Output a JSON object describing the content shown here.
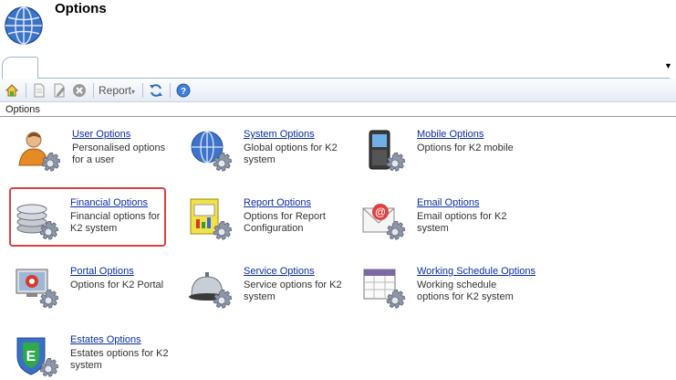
{
  "header": {
    "title": "Options",
    "icon": "globe-icon"
  },
  "toolbar": {
    "report_label": "Report",
    "buttons": [
      "home-icon",
      "new-document-icon",
      "edit-document-icon",
      "delete-icon",
      "refresh-icon",
      "help-icon"
    ]
  },
  "group": {
    "label": "Options"
  },
  "items": [
    {
      "name": "User Options",
      "desc": "Personalised options for a user",
      "icon": "user-gear-icon"
    },
    {
      "name": "System Options",
      "desc": "Global options for K2 system",
      "icon": "globe-gear-icon"
    },
    {
      "name": "Mobile Options",
      "desc": "Options for K2 mobile",
      "icon": "mobile-phone-gear-icon"
    },
    {
      "name": "Financial Options",
      "desc": "Financial options for K2 system",
      "icon": "coins-gear-icon"
    },
    {
      "name": "Report Options",
      "desc": "Options for Report Configuration",
      "icon": "report-gear-icon"
    },
    {
      "name": "Email Options",
      "desc": "Email options for K2 system",
      "icon": "envelope-gear-icon"
    },
    {
      "name": "Portal Options",
      "desc": "Options for K2 Portal",
      "icon": "monitor-portal-gear-icon"
    },
    {
      "name": "Service Options",
      "desc": "Service options for K2 system",
      "icon": "service-bell-gear-icon"
    },
    {
      "name": "Working Schedule Options",
      "desc": "Working schedule options for K2 system",
      "icon": "calendar-gear-icon"
    },
    {
      "name": "Estates Options",
      "desc": "Estates options for K2 system",
      "icon": "estates-shield-gear-icon"
    }
  ]
}
